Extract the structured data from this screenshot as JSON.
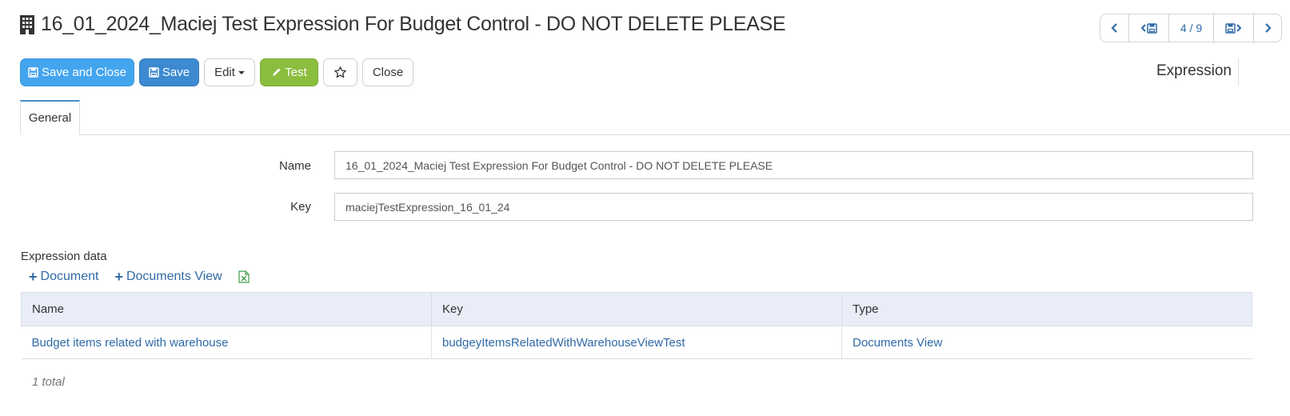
{
  "header": {
    "title": "16_01_2024_Maciej Test Expression For Budget Control - DO NOT DELETE PLEASE",
    "icon": "building-icon"
  },
  "pager": {
    "position": "4 / 9"
  },
  "toolbar": {
    "save_and_close_label": "Save and Close",
    "save_label": "Save",
    "edit_label": "Edit",
    "test_label": "Test",
    "close_label": "Close"
  },
  "record_type": "Expression",
  "tabs": [
    {
      "label": "General",
      "active": true
    }
  ],
  "form": {
    "name_label": "Name",
    "name_value": "16_01_2024_Maciej Test Expression For Budget Control - DO NOT DELETE PLEASE",
    "key_label": "Key",
    "key_value": "maciejTestExpression_16_01_24"
  },
  "expression_data": {
    "section_label": "Expression data",
    "add_document_label": "Document",
    "add_documents_view_label": "Documents View",
    "columns": [
      "Name",
      "Key",
      "Type"
    ],
    "rows": [
      {
        "name": "Budget items related with warehouse",
        "key": "budgeyItemsRelatedWithWarehouseViewTest",
        "type": "Documents View"
      }
    ],
    "total": "1 total"
  },
  "colors": {
    "primary_blue": "#44a5ef",
    "save_blue": "#3d8ad1",
    "test_green": "#8bbd3e",
    "link_blue": "#2f6aa6",
    "header_bg": "#e9edf7",
    "excel_green": "#3f9b48"
  }
}
